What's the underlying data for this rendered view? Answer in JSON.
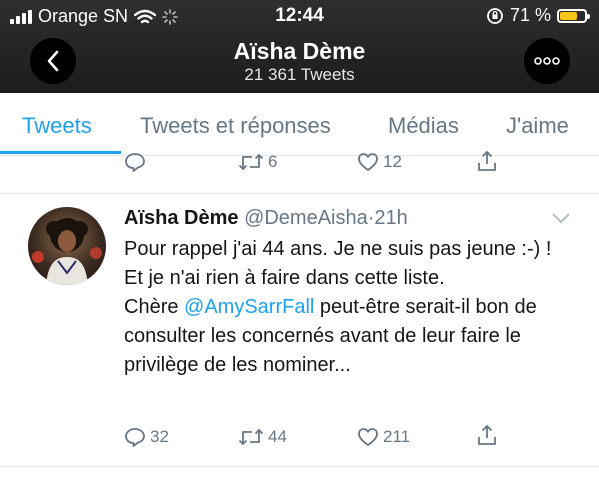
{
  "status_bar": {
    "carrier": "Orange SN",
    "time": "12:44",
    "battery_percent": "71 %",
    "battery_level": 0.71,
    "battery_color": "#f5c518"
  },
  "header": {
    "title": "Aïsha Dème",
    "tweet_count": "21 361 Tweets",
    "back_icon": "chevron-left-icon",
    "more_icon": "more-dots-icon"
  },
  "tabs": [
    {
      "label": "Tweets",
      "active": true
    },
    {
      "label": "Tweets et réponses",
      "active": false
    },
    {
      "label": "Médias",
      "active": false
    },
    {
      "label": "J'aime",
      "active": false
    }
  ],
  "previous_tweet_actions": {
    "reply": "",
    "retweet": "6",
    "like": "12"
  },
  "tweet": {
    "name": "Aïsha Dème",
    "handle": "@DemeAisha",
    "dot": "·",
    "time": "21h",
    "text_line1": "Pour rappel j'ai 44 ans. Je ne suis pas jeune :-) ! Et je n'ai rien à faire dans cette liste.",
    "text_prefix": "Chère ",
    "mention": "@AmySarrFall",
    "text_suffix": "  peut-être serait-il bon de consulter les concernés avant de leur faire le privilège de les nominer...",
    "replies": "32",
    "retweets": "44",
    "likes": "211"
  },
  "colors": {
    "accent": "#1da1f2",
    "muted": "#657786",
    "header_bg": "#2a2a2a"
  }
}
